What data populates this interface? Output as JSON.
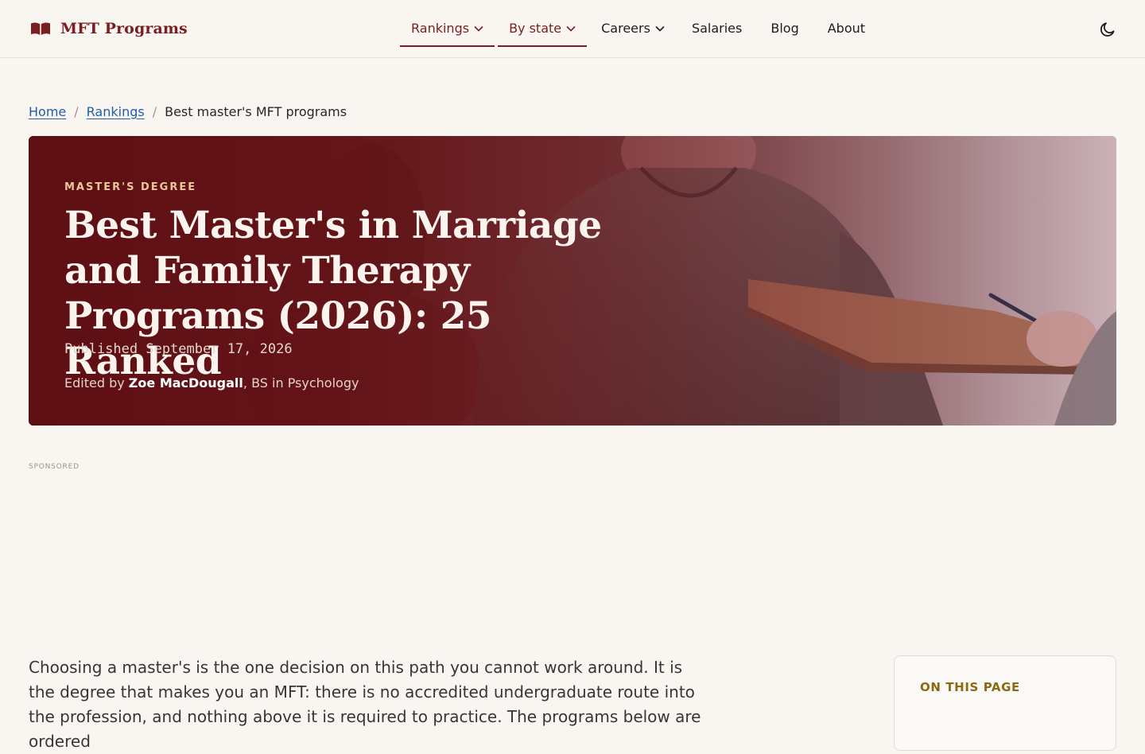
{
  "header": {
    "brand": "MFT Programs",
    "nav": [
      {
        "label": "Rankings",
        "dropdown": true,
        "active": true
      },
      {
        "label": "By state",
        "dropdown": true,
        "active": true
      },
      {
        "label": "Careers",
        "dropdown": true,
        "active": false
      },
      {
        "label": "Salaries",
        "dropdown": false,
        "active": false
      },
      {
        "label": "Blog",
        "dropdown": false,
        "active": false
      },
      {
        "label": "About",
        "dropdown": false,
        "active": false
      }
    ],
    "theme_toggle_icon": "moon-icon"
  },
  "breadcrumb": {
    "home": "Home",
    "rankings": "Rankings",
    "separator": "/",
    "current": "Best master's MFT programs"
  },
  "hero": {
    "eyebrow": "MASTER'S DEGREE",
    "title": "Best Master's in Marriage and Family Therapy Programs (2026): 25 Ranked",
    "published": "Published September 17, 2026",
    "byline_prefix": "Edited by",
    "editor": "Zoe MacDougall",
    "credential": ", BS in Psychology"
  },
  "sponsored_label": "SPONSORED",
  "intro_text": "Choosing a master's is the one decision on this path you cannot work around. It is the degree that makes you an MFT: there is no accredited undergraduate route into the profession, and nothing above it is required to practice. The programs below are ordered",
  "toc": {
    "title": "ON THIS PAGE"
  },
  "colors": {
    "brand": "#7a1f21",
    "link": "#1e5fa8",
    "eyebrow": "#e9c79a",
    "toc_title": "#8a6a12",
    "background": "#f9f6f2"
  }
}
